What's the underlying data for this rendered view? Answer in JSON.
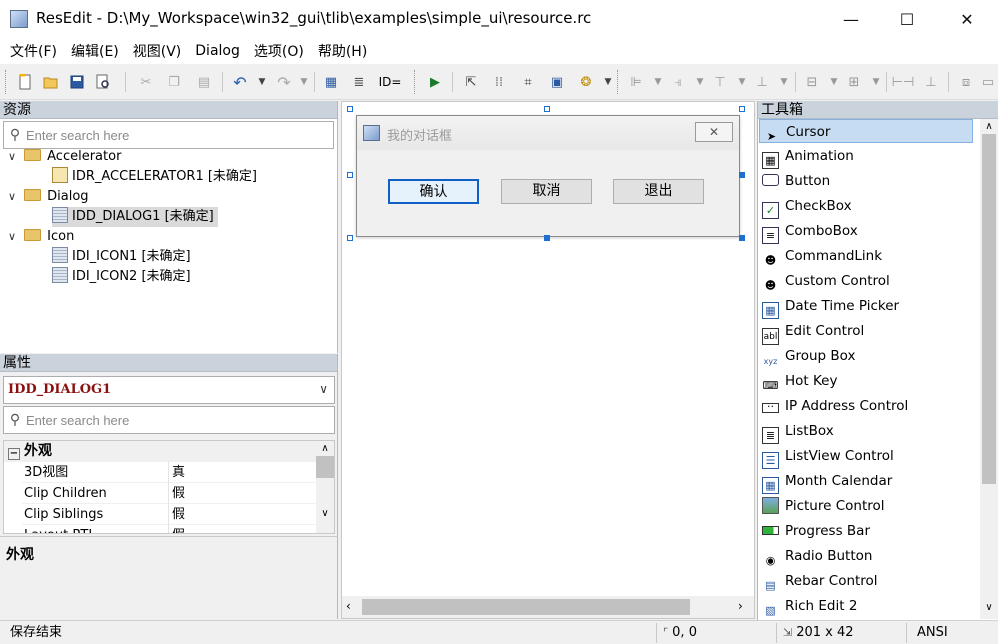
{
  "window": {
    "title": "ResEdit - D:\\My_Workspace\\win32_gui\\tlib\\examples\\simple_ui\\resource.rc",
    "minimize": "—",
    "maximize": "☐",
    "close": "✕"
  },
  "menu": [
    "文件(F)",
    "编辑(E)",
    "视图(V)",
    "Dialog",
    "选项(O)",
    "帮助(H)"
  ],
  "toolbar": {
    "id_label": "ID="
  },
  "resources": {
    "header": "资源",
    "search_placeholder": "Enter search here",
    "tree": [
      {
        "label": "Accelerator",
        "children": [
          "IDR_ACCELERATOR1 [未确定]"
        ]
      },
      {
        "label": "Dialog",
        "children": [
          "IDD_DIALOG1 [未确定]"
        ]
      },
      {
        "label": "Icon",
        "children": [
          "IDI_ICON1 [未确定]",
          "IDI_ICON2 [未确定]"
        ]
      }
    ]
  },
  "properties": {
    "header": "属性",
    "selected": "IDD_DIALOG1",
    "search_placeholder": "Enter search here",
    "category": "外观",
    "rows": [
      {
        "name": "3D视图",
        "value": "真"
      },
      {
        "name": "Clip Children",
        "value": "假"
      },
      {
        "name": "Clip Siblings",
        "value": "假"
      },
      {
        "name": "Layout RTL",
        "value": "假"
      }
    ],
    "description_title": "外观"
  },
  "dialog": {
    "title": "我的对话框",
    "buttons": [
      "确认",
      "取消",
      "退出"
    ]
  },
  "toolbox": {
    "header": "工具箱",
    "items": [
      "Cursor",
      "Animation",
      "Button",
      "CheckBox",
      "ComboBox",
      "CommandLink",
      "Custom Control",
      "Date Time Picker",
      "Edit Control",
      "Group Box",
      "Hot Key",
      "IP Address Control",
      "ListBox",
      "ListView Control",
      "Month Calendar",
      "Picture Control",
      "Progress Bar",
      "Radio Button",
      "Rebar Control",
      "Rich Edit 2"
    ],
    "selected": "Cursor"
  },
  "status": {
    "message": "保存结束",
    "position": "0, 0",
    "size": "201 x 42",
    "encoding": "ANSI"
  }
}
